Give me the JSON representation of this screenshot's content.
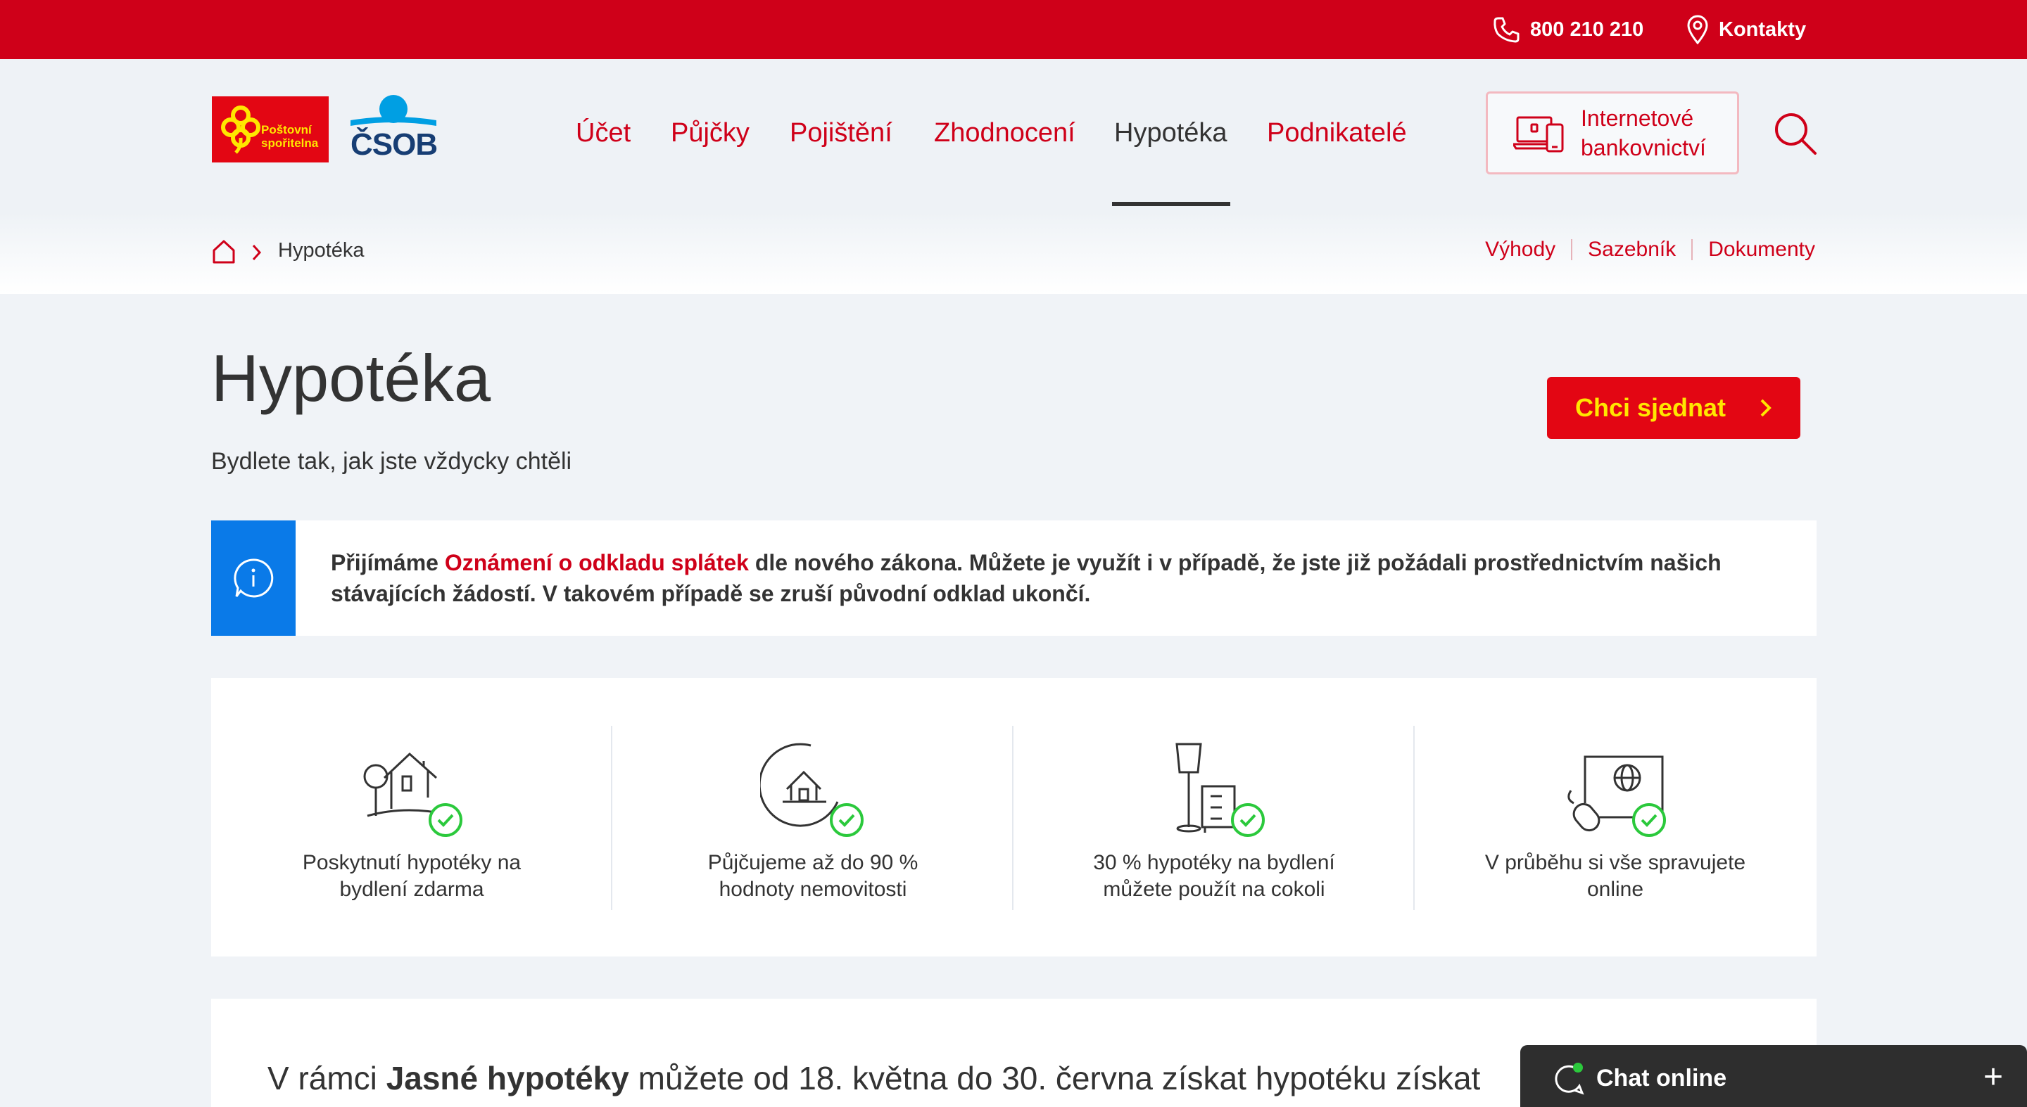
{
  "topbar": {
    "phone": "800 210 210",
    "contacts": "Kontakty"
  },
  "brand": {
    "postovni_line1": "Poštovní",
    "postovni_line2": "spořitelna",
    "csob": "ČSOB"
  },
  "nav": {
    "items": [
      "Účet",
      "Půjčky",
      "Pojištění",
      "Zhodnocení",
      "Hypotéka",
      "Podnikatelé"
    ],
    "active": "Hypotéka"
  },
  "internet_banking": {
    "line1": "Internetové",
    "line2": "bankovnictví"
  },
  "breadcrumb": {
    "current": "Hypotéka"
  },
  "subnav": [
    "Výhody",
    "Sazebník",
    "Dokumenty"
  ],
  "hero": {
    "title": "Hypotéka",
    "lead": "Bydlete tak, jak jste vždycky chtěli",
    "cta": "Chci sjednat"
  },
  "info": {
    "before": "Přijímáme ",
    "link": "Oznámení o odkladu splátek",
    "after": " dle nového zákona. Můžete je využít i v případě, že jste již požádali prostřednictvím našich stávajících žádostí. V takovém případě se zruší původní odklad ukončí."
  },
  "features": [
    {
      "line1": "Poskytnutí hypotéky na",
      "line2": "bydlení zdarma",
      "icon": "house-tree-check-icon"
    },
    {
      "line1": "Půjčujeme až do 90 %",
      "line2": "hodnoty nemovitosti",
      "icon": "house-circle-check-icon"
    },
    {
      "line1": "30 % hypotéky na bydlení",
      "line2": "můžete použít na cokoli",
      "icon": "furniture-check-icon"
    },
    {
      "line1": "V průběhu si vše spravujete",
      "line2": "online",
      "icon": "computer-check-icon"
    }
  ],
  "teaser": {
    "before": "V rámci ",
    "bold": "Jasné hypotéky",
    "after": " můžete od 18. května do 30. června získat hypotéku získat"
  },
  "chat": {
    "label": "Chat online",
    "plus": "+"
  },
  "colors": {
    "brand_red": "#cf0019",
    "cta_yellow": "#ffe600",
    "info_blue": "#0a7ae8",
    "check_green": "#2bc93c"
  }
}
